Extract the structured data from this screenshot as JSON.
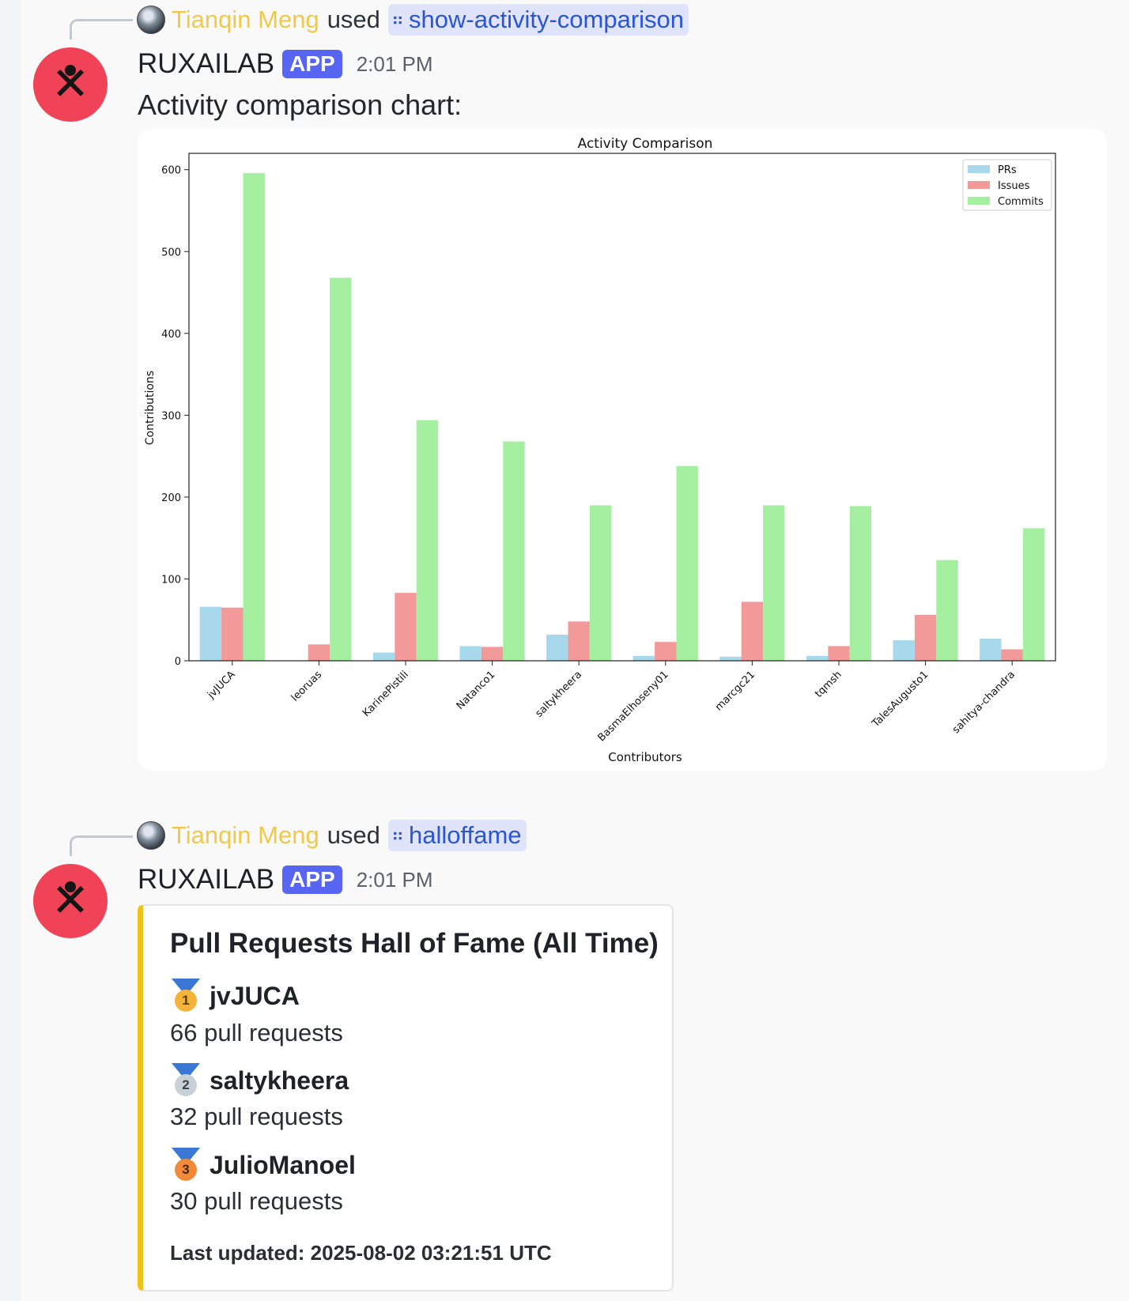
{
  "messages": [
    {
      "reply": {
        "user": "Tianqin Meng",
        "action": "used",
        "command": "show-activity-comparison"
      },
      "author": "RUXAILAB",
      "badge": "APP",
      "time": "2:01 PM",
      "text": "Activity comparison chart:"
    },
    {
      "reply": {
        "user": "Tianqin Meng",
        "action": "used",
        "command": "halloffame"
      },
      "author": "RUXAILAB",
      "badge": "APP",
      "time": "2:01 PM"
    }
  ],
  "embed": {
    "title": "Pull Requests Hall of Fame (All Time)",
    "entries": [
      {
        "rank": "1",
        "name": "jvJUCA",
        "count": "66 pull requests"
      },
      {
        "rank": "2",
        "name": "saltykheera",
        "count": "32 pull requests"
      },
      {
        "rank": "3",
        "name": "JulioManoel",
        "count": "30 pull requests"
      }
    ],
    "footer": "Last updated: 2025-08-02 03:21:51 UTC",
    "accent_color": "#f0c31b"
  },
  "chart_data": {
    "type": "bar",
    "title": "Activity Comparison",
    "xlabel": "Contributors",
    "ylabel": "Contributions",
    "ylim": [
      0,
      620
    ],
    "yticks": [
      0,
      100,
      200,
      300,
      400,
      500,
      600
    ],
    "legend_position": "top-right",
    "grid": false,
    "categories": [
      "jvJUCA",
      "leoruas",
      "KarinePistili",
      "Natanco1",
      "saltykheera",
      "BasmaElhoseny01",
      "marcgc21",
      "tqmsh",
      "TalesAugusto1",
      "sahitya-chandra"
    ],
    "series": [
      {
        "name": "PRs",
        "color": "#a8d8ec",
        "values": [
          66,
          0,
          10,
          18,
          32,
          6,
          5,
          6,
          25,
          27
        ]
      },
      {
        "name": "Issues",
        "color": "#f29a9a",
        "values": [
          65,
          20,
          83,
          17,
          48,
          23,
          72,
          18,
          56,
          14
        ]
      },
      {
        "name": "Commits",
        "color": "#a5efa0",
        "values": [
          596,
          468,
          294,
          268,
          190,
          238,
          190,
          189,
          123,
          162
        ]
      }
    ]
  },
  "colors": {
    "accent": "#5865f2",
    "username": "#f0c94a",
    "command": "#2a55d3",
    "avatar": "#f04358"
  }
}
